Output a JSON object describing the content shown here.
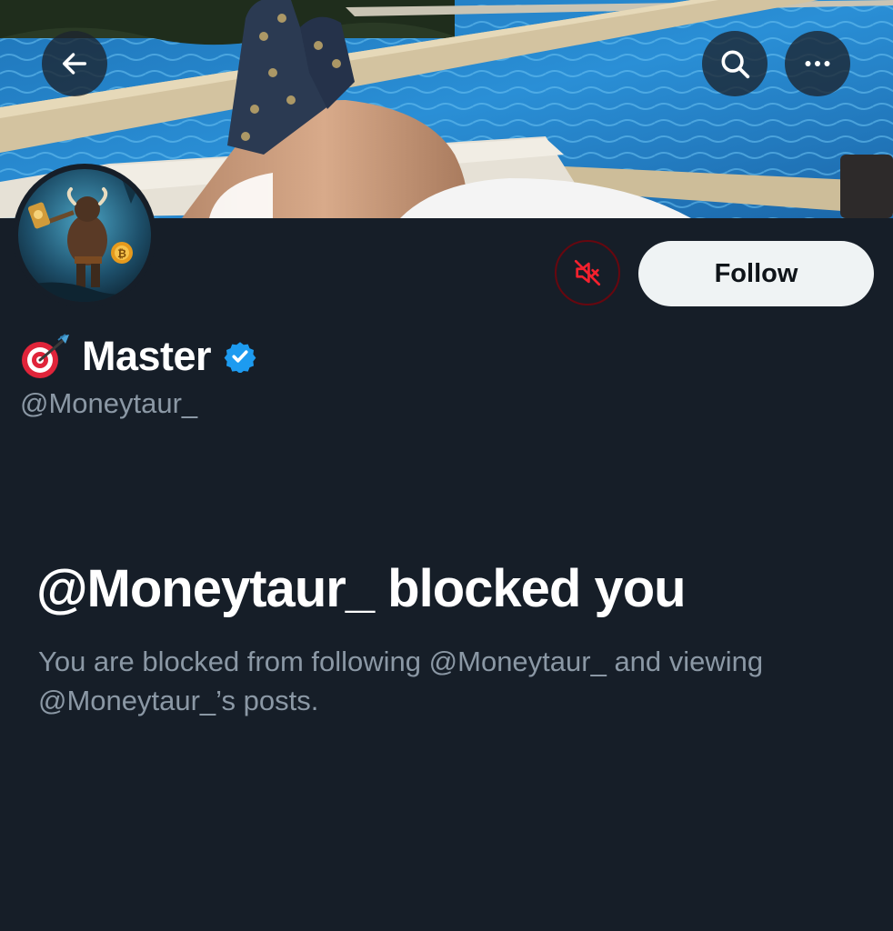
{
  "header": {
    "back_icon": "arrow-left-icon",
    "search_icon": "search-icon",
    "more_icon": "more-horizontal-icon"
  },
  "profile": {
    "display_name": "Master",
    "name_emoji": "direct-hit-target-emoji",
    "verified_icon": "verified-badge-icon",
    "handle": "@Moneytaur_",
    "follow_label": "Follow",
    "unmute_icon": "speaker-muted-icon"
  },
  "blocked": {
    "title": "@Moneytaur_ blocked you",
    "description": "You are blocked from following @Moneytaur_ and viewing @Moneytaur_’s posts."
  },
  "colors": {
    "background": "#161e28",
    "text_primary": "#ffffff",
    "text_secondary": "#8b98a5",
    "follow_bg": "#eff3f4",
    "mute_red": "#f4212e",
    "verified_blue": "#1d9bf0"
  }
}
